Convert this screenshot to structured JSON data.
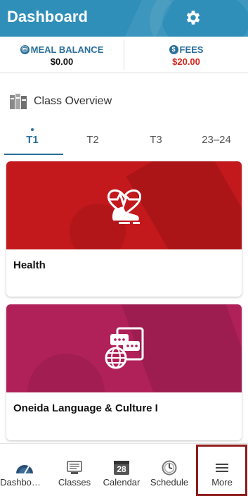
{
  "header": {
    "title": "Dashboard"
  },
  "balances": {
    "meal": {
      "label": "MEAL BALANCE",
      "value": "$0.00"
    },
    "fees": {
      "label": "FEES",
      "value": "$20.00"
    }
  },
  "overview": {
    "title": "Class Overview"
  },
  "tabs": [
    {
      "label": "T1",
      "active": true
    },
    {
      "label": "T2"
    },
    {
      "label": "T3"
    },
    {
      "label": "23–24"
    }
  ],
  "cards": [
    {
      "name": "Health",
      "color": "#c3181c",
      "icon": "heart-rate-shoe-icon"
    },
    {
      "name": "Oneida Language & Culture I",
      "color": "#b0215a",
      "icon": "language-globe-chat-icon"
    },
    {
      "name": "",
      "color": "#3f8f2a"
    }
  ],
  "nav": [
    {
      "label": "Dashbo…",
      "icon": "dashboard-icon"
    },
    {
      "label": "Classes",
      "icon": "classes-icon"
    },
    {
      "label": "Calendar",
      "icon": "calendar-icon",
      "day": "28"
    },
    {
      "label": "Schedule",
      "icon": "schedule-icon"
    },
    {
      "label": "More",
      "icon": "menu-icon",
      "highlighted": true
    }
  ]
}
